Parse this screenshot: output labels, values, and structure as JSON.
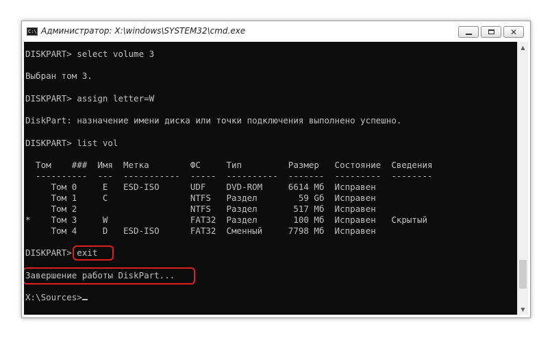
{
  "window": {
    "title": "Администратор: X:\\windows\\SYSTEM32\\cmd.exe",
    "icon": "C:\\"
  },
  "controls": {
    "close_glyph": "✕"
  },
  "console": {
    "lines": [
      "DISKPART> select volume 3",
      "",
      "Выбран том 3.",
      "",
      "DISKPART> assign letter=W",
      "",
      "DiskPart: назначение имени диска или точки подключения выполнено успешно.",
      "",
      "DISKPART> list vol",
      "",
      "  Том    ###  Имя  Метка        ФС     Тип         Размер   Состояние  Сведения",
      "  ----------  ---  -----------  -----  ----------  -------  ---------  --------",
      "     Том 0     E   ESD-ISO      UDF    DVD-ROM     6614 Мб  Исправен",
      "     Том 1     C                NTFS   Раздел        59 Gб  Исправен",
      "     Том 2                      NTFS   Раздел       517 Мб  Исправен",
      "*    Том 3     W                FAT32  Раздел       100 Мб  Исправен   Скрытый",
      "     Том 4     D   ESD-ISO      FAT32  Сменный     7798 Мб  Исправен",
      "",
      "DISKPART> exit",
      "",
      "Завершение работы DiskPart...",
      "",
      "X:\\Sources>"
    ]
  }
}
